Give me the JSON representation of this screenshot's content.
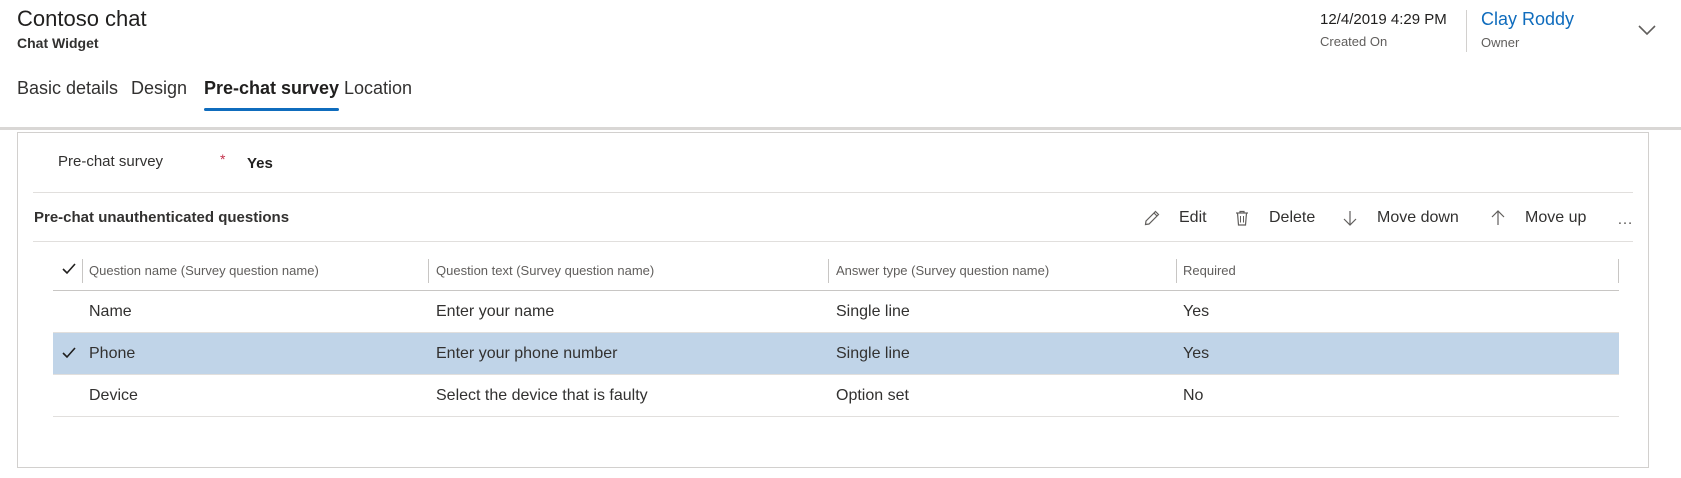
{
  "header": {
    "title": "Contoso chat",
    "subtitle": "Chat Widget",
    "created_on": {
      "value": "12/4/2019 4:29 PM",
      "label": "Created On"
    },
    "owner": {
      "value": "Clay Roddy",
      "label": "Owner"
    },
    "expand_icon": "chevron-down-icon"
  },
  "tabs": [
    {
      "label": "Basic details",
      "active": false
    },
    {
      "label": "Design",
      "active": false
    },
    {
      "label": "Pre-chat survey",
      "active": true
    },
    {
      "label": "Location",
      "active": false
    }
  ],
  "form": {
    "field": {
      "label": "Pre-chat survey",
      "required_marker": "*",
      "value": "Yes"
    }
  },
  "subgrid": {
    "title": "Pre-chat unauthenticated questions",
    "commands": [
      {
        "label": "Edit",
        "icon": "edit-icon"
      },
      {
        "label": "Delete",
        "icon": "delete-icon"
      },
      {
        "label": "Move down",
        "icon": "arrow-down-icon"
      },
      {
        "label": "Move up",
        "icon": "arrow-up-icon"
      }
    ],
    "more_icon": "…",
    "columns": [
      "Question name (Survey question name)",
      "Question text (Survey question name)",
      "Answer type (Survey question name)",
      "Required"
    ],
    "rows": [
      {
        "name": "Name",
        "text": "Enter your name",
        "type": "Single line",
        "required": "Yes",
        "selected": false
      },
      {
        "name": "Phone",
        "text": "Enter your phone number",
        "type": "Single line",
        "required": "Yes",
        "selected": true
      },
      {
        "name": "Device",
        "text": "Select the device that is faulty",
        "type": "Option set",
        "required": "No",
        "selected": false
      }
    ]
  },
  "colors": {
    "accent": "#0f6cbd",
    "selected_row": "#c0d4e8",
    "required": "#c4314b"
  }
}
